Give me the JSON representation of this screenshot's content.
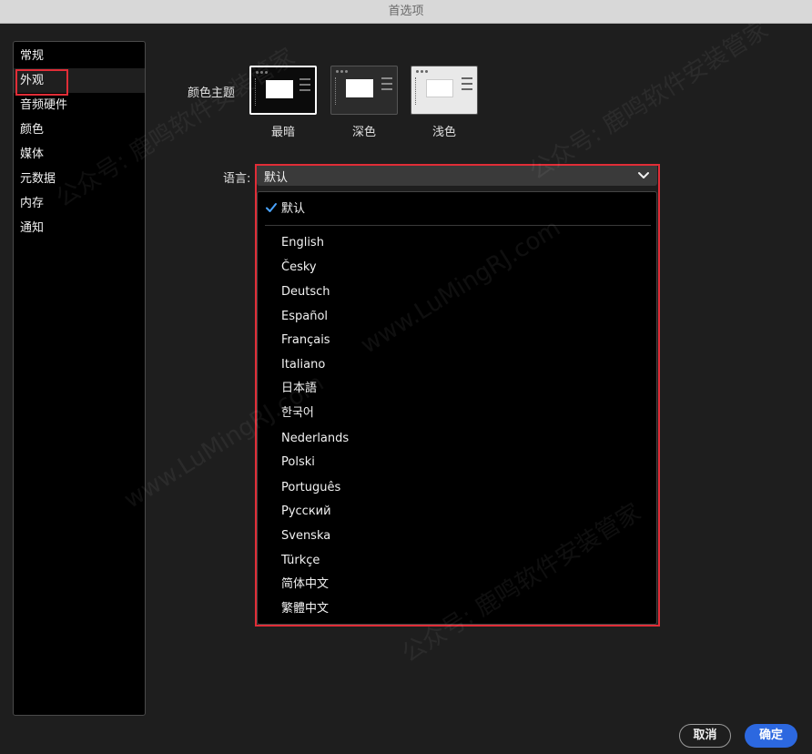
{
  "window": {
    "title": "首选项"
  },
  "sidebar": {
    "items": [
      {
        "label": "常规"
      },
      {
        "label": "外观"
      },
      {
        "label": "音频硬件"
      },
      {
        "label": "颜色"
      },
      {
        "label": "媒体"
      },
      {
        "label": "元数据"
      },
      {
        "label": "内存"
      },
      {
        "label": "通知"
      }
    ],
    "selected_index": 1
  },
  "appearance": {
    "theme_label": "颜色主题",
    "themes": [
      {
        "label": "最暗",
        "selected": true
      },
      {
        "label": "深色",
        "selected": false
      },
      {
        "label": "浅色",
        "selected": false
      }
    ],
    "language_label": "语言:",
    "language_value": "默认",
    "language_options": [
      "默认",
      "English",
      "Česky",
      "Deutsch",
      "Español",
      "Français",
      "Italiano",
      "日本語",
      "한국어",
      "Nederlands",
      "Polski",
      "Português",
      "Русский",
      "Svenska",
      "Türkçe",
      "简体中文",
      "繁體中文"
    ],
    "checked_option": "默认"
  },
  "buttons": {
    "cancel": "取消",
    "ok": "确定"
  },
  "colors": {
    "accent": "#2c68e0",
    "highlight": "#e02d37",
    "check": "#4aa3ff"
  },
  "watermark": {
    "text_a": "公众号: 鹿鸣软件安装管家",
    "text_b": "www.LuMingRJ.com"
  }
}
